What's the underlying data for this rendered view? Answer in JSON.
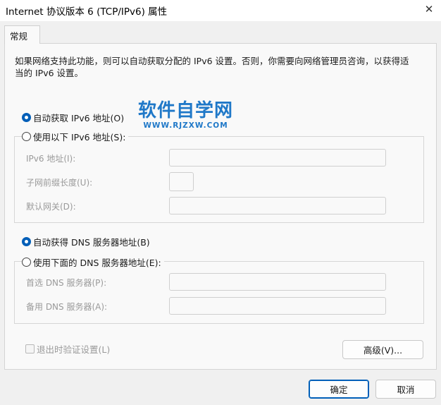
{
  "window": {
    "title": "Internet 协议版本 6 (TCP/IPv6) 属性",
    "close_glyph": "✕"
  },
  "tab": {
    "label": "常规"
  },
  "description": "如果网络支持此功能，则可以自动获取分配的 IPv6 设置。否则，你需要向网络管理员咨询，以获得适当的 IPv6 设置。",
  "watermark": {
    "main": "软件自学网",
    "sub": "WWW.RJZXW.COM"
  },
  "ip": {
    "auto_label": "自动获取 IPv6 地址(O)",
    "auto_checked": true,
    "manual_label": "使用以下 IPv6 地址(S):",
    "manual_checked": false,
    "fields": {
      "address_label": "IPv6 地址(I):",
      "address_value": "",
      "prefix_label": "子网前缀长度(U):",
      "prefix_value": "",
      "gateway_label": "默认网关(D):",
      "gateway_value": ""
    }
  },
  "dns": {
    "auto_label": "自动获得 DNS 服务器地址(B)",
    "auto_checked": true,
    "manual_label": "使用下面的 DNS 服务器地址(E):",
    "manual_checked": false,
    "fields": {
      "preferred_label": "首选 DNS 服务器(P):",
      "preferred_value": "",
      "alternate_label": "备用 DNS 服务器(A):",
      "alternate_value": ""
    }
  },
  "validate": {
    "label": "退出时验证设置(L)",
    "checked": false
  },
  "buttons": {
    "advanced": "高级(V)...",
    "ok": "确定",
    "cancel": "取消"
  },
  "colors": {
    "accent": "#005fb8",
    "watermark": "#1f78c8",
    "disabled_text": "#9a9a9a"
  }
}
